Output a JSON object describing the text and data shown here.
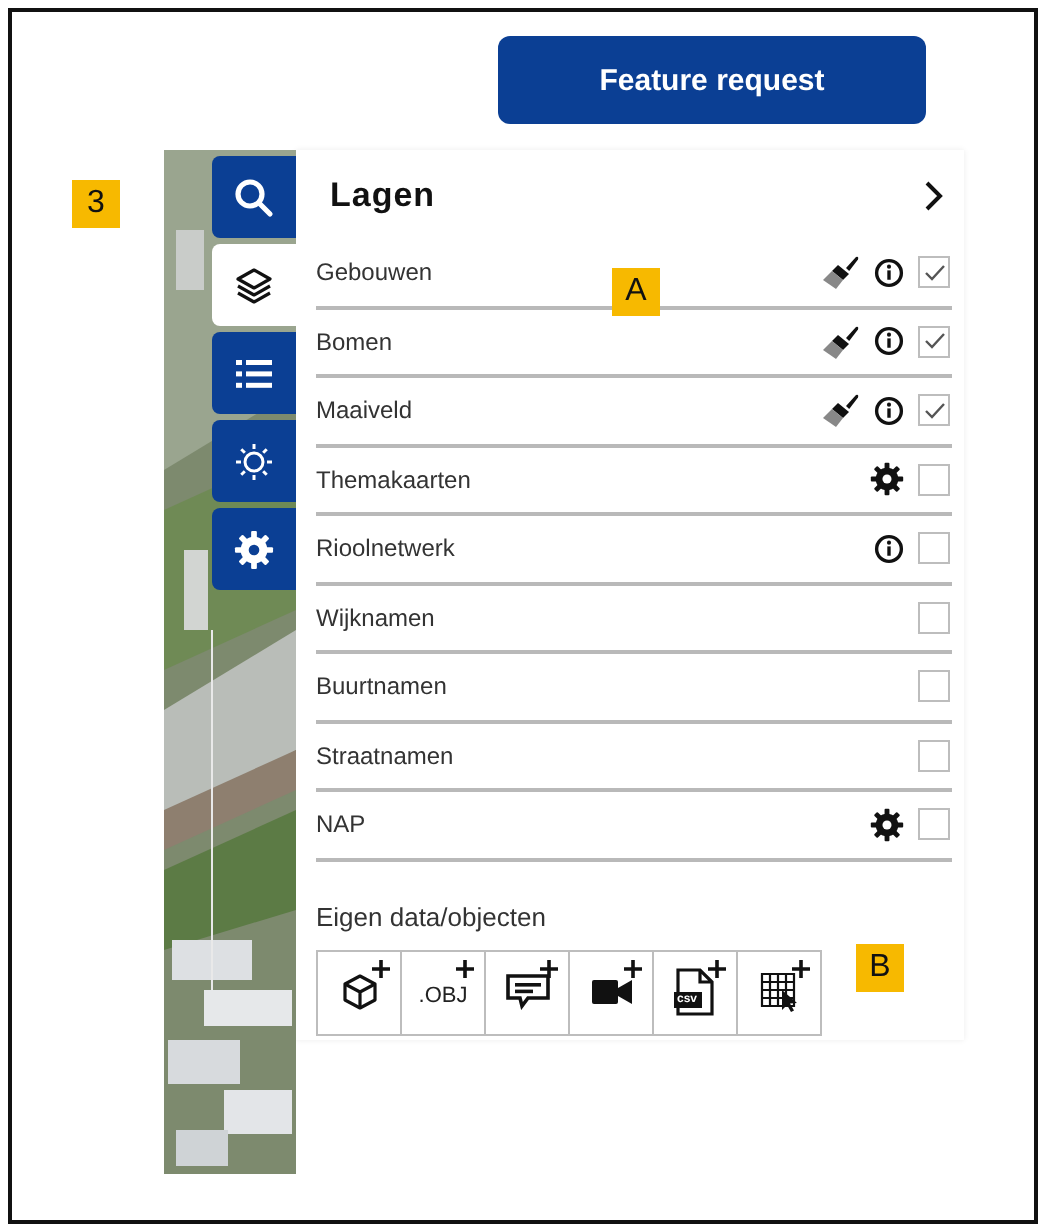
{
  "feature_button": "Feature request",
  "callouts": [
    {
      "label": "3"
    },
    {
      "label": "A"
    },
    {
      "label": "B"
    }
  ],
  "sidebar": {
    "items": [
      {
        "kind": "search",
        "selected": false
      },
      {
        "kind": "layers",
        "selected": true
      },
      {
        "kind": "list",
        "selected": false
      },
      {
        "kind": "sun",
        "selected": false
      },
      {
        "kind": "settings",
        "selected": false
      }
    ]
  },
  "panel": {
    "title": "Lagen",
    "layers": [
      {
        "name": "Gebouwen",
        "checked": true,
        "actions": [
          {
            "kind": "style"
          },
          {
            "kind": "info"
          }
        ]
      },
      {
        "name": "Bomen",
        "checked": true,
        "actions": [
          {
            "kind": "style"
          },
          {
            "kind": "info"
          }
        ]
      },
      {
        "name": "Maaiveld",
        "checked": true,
        "actions": [
          {
            "kind": "style"
          },
          {
            "kind": "info"
          }
        ]
      },
      {
        "name": "Themakaarten",
        "checked": false,
        "actions": [
          {
            "kind": "settings"
          }
        ]
      },
      {
        "name": "Rioolnetwerk",
        "checked": false,
        "actions": [
          {
            "kind": "info"
          }
        ]
      },
      {
        "name": "Wijknamen",
        "checked": false
      },
      {
        "name": "Buurtnamen",
        "checked": false
      },
      {
        "name": "Straatnamen",
        "checked": false
      },
      {
        "name": "NAP",
        "checked": false,
        "actions": [
          {
            "kind": "settings"
          }
        ]
      }
    ]
  },
  "own_data": {
    "title": "Eigen data/objecten",
    "tools": [
      {
        "kind": "cube"
      },
      {
        "kind": "text",
        "label": ".OBJ"
      },
      {
        "kind": "annotation"
      },
      {
        "kind": "camera"
      },
      {
        "kind": "file",
        "label": "csv"
      },
      {
        "kind": "grid"
      }
    ]
  }
}
